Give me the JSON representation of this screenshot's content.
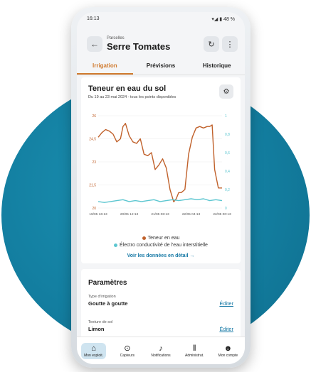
{
  "status": {
    "time": "16:13",
    "indicators": "▾◢ ▮ 48 %"
  },
  "header": {
    "breadcrumb": "Parcelles",
    "title": "Serre Tomates",
    "back_icon": "arrow-left-icon",
    "refresh_icon": "refresh-icon",
    "more_icon": "more-vertical-icon"
  },
  "tabs": [
    {
      "label": "Irrigation",
      "active": true
    },
    {
      "label": "Prévisions",
      "active": false
    },
    {
      "label": "Historique",
      "active": false
    }
  ],
  "card": {
    "title": "Teneur en eau du sol",
    "subtitle": "Du 19 au 23 mai 2024 - tous les points disponibles",
    "detail_link": "Voir les données en détail →"
  },
  "chart_data": {
    "type": "line",
    "x_ticks": [
      "19/05 16:13",
      "20/05 12:13",
      "21/05 08:13",
      "22/05 04:13",
      "22/05 00:13"
    ],
    "y_left_ticks": [
      "26",
      "24,5",
      "23",
      "21,5",
      "20"
    ],
    "y_right_ticks": [
      "1",
      "0,8",
      "0,6",
      "0,4",
      "0,2",
      "0"
    ],
    "ylim_left": [
      20,
      26
    ],
    "ylim_right": [
      0,
      1
    ],
    "grid": true,
    "series": [
      {
        "name": "Teneur en eau",
        "axis": "left",
        "color": "#c0612b",
        "x": [
          0,
          0.03,
          0.06,
          0.09,
          0.12,
          0.15,
          0.18,
          0.2,
          0.22,
          0.25,
          0.28,
          0.31,
          0.34,
          0.37,
          0.4,
          0.43,
          0.46,
          0.49,
          0.52,
          0.55,
          0.58,
          0.61,
          0.63,
          0.65,
          0.67,
          0.7,
          0.73,
          0.76,
          0.79,
          0.82,
          0.85,
          0.88,
          0.9,
          0.92,
          0.94,
          0.97,
          1.0
        ],
        "y": [
          24.6,
          24.9,
          25.1,
          25.0,
          24.8,
          24.3,
          24.5,
          25.3,
          25.5,
          24.7,
          24.3,
          24.2,
          24.5,
          23.5,
          23.4,
          23.6,
          22.5,
          22.8,
          23.2,
          22.6,
          21.2,
          20.4,
          20.6,
          21.0,
          21.0,
          21.2,
          23.5,
          24.6,
          25.2,
          25.3,
          25.2,
          25.3,
          25.3,
          25.4,
          22.5,
          21.3,
          21.3
        ]
      },
      {
        "name": "Électro conductivité de l'eau interstitielle",
        "axis": "right",
        "color": "#5cc6d0",
        "x": [
          0,
          0.05,
          0.1,
          0.15,
          0.2,
          0.25,
          0.3,
          0.35,
          0.4,
          0.45,
          0.5,
          0.55,
          0.6,
          0.65,
          0.7,
          0.75,
          0.8,
          0.85,
          0.9,
          0.95,
          1.0
        ],
        "y": [
          0.07,
          0.06,
          0.07,
          0.08,
          0.09,
          0.07,
          0.08,
          0.07,
          0.08,
          0.09,
          0.07,
          0.08,
          0.09,
          0.08,
          0.09,
          0.1,
          0.09,
          0.1,
          0.08,
          0.09,
          0.08
        ]
      }
    ]
  },
  "params": {
    "title": "Paramètres",
    "items": [
      {
        "label": "Type d'irrigation",
        "value": "Goutte à goutte",
        "action": "Éditer"
      },
      {
        "label": "Texture de sol",
        "value": "Limon",
        "action": "Éditer"
      }
    ]
  },
  "nav": [
    {
      "label": "Mon exploit.",
      "icon": "farm-icon",
      "glyph": "⌂",
      "active": true
    },
    {
      "label": "Capteurs",
      "icon": "sensor-icon",
      "glyph": "⊙",
      "active": false
    },
    {
      "label": "Notifications",
      "icon": "bell-icon",
      "glyph": "♪",
      "active": false
    },
    {
      "label": "Administrat.",
      "icon": "admin-icon",
      "glyph": "⦀",
      "active": false
    },
    {
      "label": "Mon compte",
      "icon": "account-icon",
      "glyph": "☻",
      "active": false
    }
  ]
}
